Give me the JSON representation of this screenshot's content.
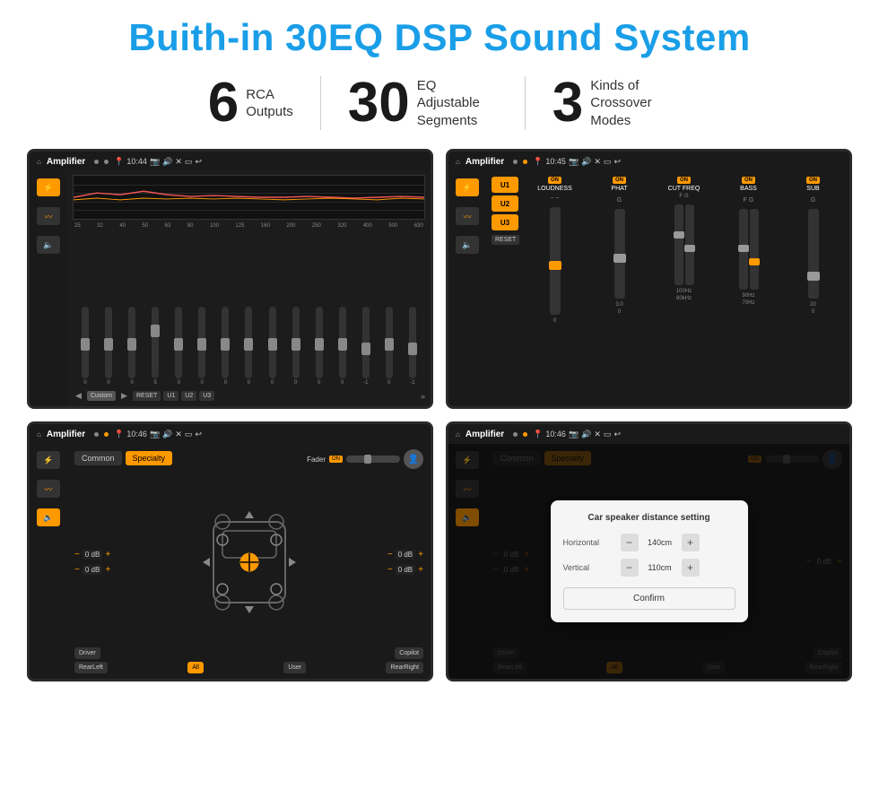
{
  "page": {
    "title": "Buith-in 30EQ DSP Sound System",
    "stats": [
      {
        "number": "6",
        "label": "RCA\nOutputs"
      },
      {
        "number": "30",
        "label": "EQ Adjustable\nSegments"
      },
      {
        "number": "3",
        "label": "Kinds of\nCrossover Modes"
      }
    ]
  },
  "screens": {
    "screen1": {
      "topbar": {
        "title": "Amplifier",
        "time": "10:44"
      },
      "eq_freqs": [
        "25",
        "32",
        "40",
        "50",
        "63",
        "80",
        "100",
        "125",
        "160",
        "200",
        "250",
        "320",
        "400",
        "500",
        "630"
      ],
      "eq_values": [
        "0",
        "0",
        "0",
        "5",
        "0",
        "0",
        "0",
        "0",
        "0",
        "0",
        "0",
        "0",
        "-1",
        "0",
        "-1"
      ],
      "bottom_buttons": [
        "Custom",
        "RESET",
        "U1",
        "U2",
        "U3"
      ]
    },
    "screen2": {
      "topbar": {
        "title": "Amplifier",
        "time": "10:45"
      },
      "presets": [
        "U1",
        "U2",
        "U3"
      ],
      "channels": [
        "LOUDNESS",
        "PHAT",
        "CUT FREQ",
        "BASS",
        "SUB"
      ],
      "reset_label": "RESET"
    },
    "screen3": {
      "topbar": {
        "title": "Amplifier",
        "time": "10:46"
      },
      "tabs": [
        "Common",
        "Specialty"
      ],
      "fader_label": "Fader",
      "bottom_buttons": [
        "Driver",
        "RearLeft",
        "All",
        "User",
        "RearRight",
        "Copilot"
      ],
      "vol_labels": [
        "0 dB",
        "0 dB",
        "0 dB",
        "0 dB"
      ]
    },
    "screen4": {
      "topbar": {
        "title": "Amplifier",
        "time": "10:46"
      },
      "tabs": [
        "Common",
        "Specialty"
      ],
      "dialog": {
        "title": "Car speaker distance setting",
        "horizontal_label": "Horizontal",
        "horizontal_value": "140cm",
        "vertical_label": "Vertical",
        "vertical_value": "110cm",
        "confirm_label": "Confirm"
      },
      "bottom_buttons": [
        "Driver",
        "RearLeft",
        "All",
        "User",
        "RearRight",
        "Copilot"
      ],
      "vol_labels": [
        "0 dB",
        "0 dB"
      ]
    }
  },
  "icons": {
    "home": "⌂",
    "location": "📍",
    "camera": "📷",
    "volume": "🔊",
    "back": "↩",
    "equalizer": "⚡",
    "waveform": "〰",
    "speaker": "🔈",
    "user": "👤"
  }
}
